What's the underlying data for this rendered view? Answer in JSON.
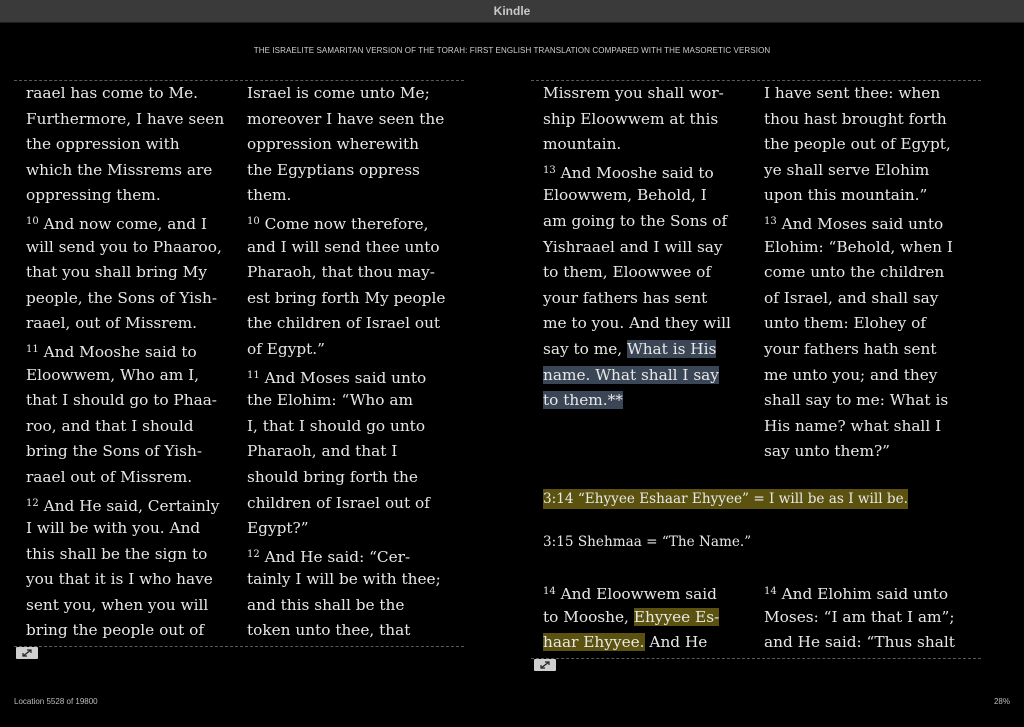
{
  "window": {
    "title": "Kindle"
  },
  "book": {
    "title": "THE ISRAELITE SAMARITAN VERSION OF THE TORAH: FIRST ENGLISH TRANSLATION COMPARED WITH THE MASORETIC VERSION"
  },
  "left_page": {
    "col1": [
      "raael has come to Me.",
      "Furthermore, I have seen",
      "the oppression with",
      "which the Missrems are",
      "oppressing them.",
      "And now come, and I",
      "will send you to Phaaroo,",
      "that you shall bring My",
      "people, the Sons of Yish-",
      "raael, out of Missrem.",
      "And Mooshe said to",
      "Eloowwem, Who am I,",
      "that I should go to Phaa-",
      "roo, and that I should",
      "bring the Sons of Yish-",
      "raael out of Missrem.",
      "And He said, Certainly",
      "I will be with you. And",
      "this shall be the sign to",
      "you that it is I who have",
      "sent you, when you will",
      "bring the people out of"
    ],
    "col2": [
      "Israel is come unto Me;",
      "moreover I have seen the",
      "oppression wherewith",
      "the Egyptians oppress",
      "them.",
      "Come now therefore,",
      "and I will send thee unto",
      "Pharaoh, that thou may-",
      "est bring forth My people",
      "the children of Israel out",
      "of Egypt.”",
      "And Moses said unto",
      "the Elohim: “Who am",
      "I, that I should go unto",
      "Pharaoh, and that I",
      "should bring forth the",
      "children of Israel out of",
      "Egypt?”",
      "And He said: “Cer-",
      "tainly I will be with thee;",
      "and this shall be the",
      "token unto thee, that"
    ],
    "verse_numbers": {
      "v10": "10",
      "v11": "11",
      "v12": "12"
    }
  },
  "right_page": {
    "col1": [
      "Missrem you shall wor-",
      "ship Eloowwem at this",
      "mountain.",
      "And Mooshe said to",
      "Eloowwem, Behold, I",
      "am going to the Sons of",
      "Yishraael and I will say",
      "to them, Eloowwee of",
      "your fathers has sent",
      "me to you. And they will",
      "say to me, ",
      "What is His",
      "name. What shall I say",
      "to them.**"
    ],
    "col2": [
      "I have sent thee: when",
      "thou hast brought forth",
      "the people out of Egypt,",
      "ye shall serve Elohim",
      "upon this mountain.”",
      "And Moses said unto",
      "Elohim: “Behold, when I",
      "come unto the children",
      "of Israel, and shall say",
      "unto them: Elohey of",
      "your fathers hath sent",
      "me unto you; and they",
      "shall say to me: What is",
      "His name? what shall I",
      "say unto them?”"
    ],
    "verse_numbers": {
      "v13": "13",
      "v14": "14"
    },
    "note1": "3:14 “Ehyyee Eshaar Ehyyee” = I will be as I will be.",
    "note2": "3:15 Shehmaa = “The Name.”",
    "bottom_col1": {
      "l1": "And Eloowwem said",
      "l2a": "to Mooshe, ",
      "l2b": "Ehyyee Es-",
      "l3a": "haar Ehyyee.",
      "l3b": " And He"
    },
    "bottom_col2": {
      "l1": "And Elohim said unto",
      "l2": "Moses: “I am that I am”;",
      "l3": "and He said: “Thus shalt"
    }
  },
  "footer": {
    "location": "Location 5528 of 19800",
    "percent": "28%"
  },
  "icons": {
    "expand": "expand-icon"
  }
}
